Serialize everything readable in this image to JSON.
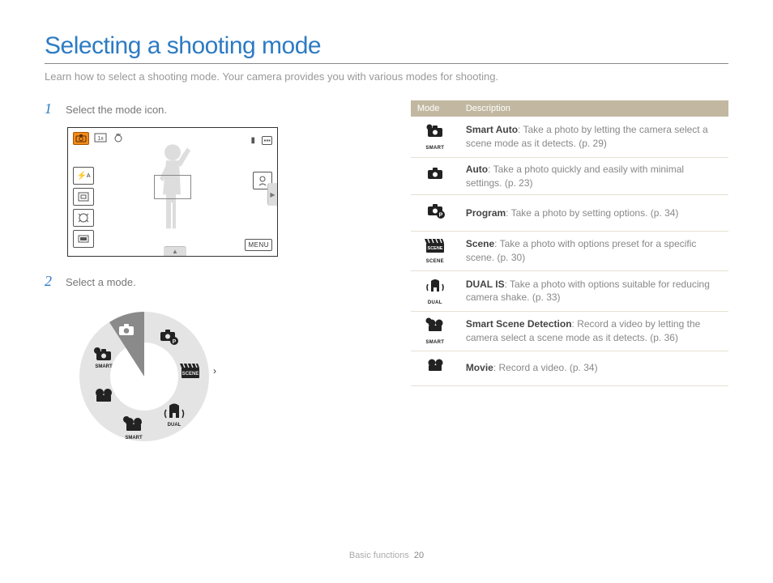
{
  "title": "Selecting a shooting mode",
  "intro": "Learn how to select a shooting mode. Your camera provides you with various modes for shooting.",
  "steps": {
    "s1_num": "1",
    "s1_text": "Select the mode icon.",
    "s2_num": "2",
    "s2_text": "Select a mode."
  },
  "lcd": {
    "menu_label": "MENU"
  },
  "table": {
    "header_mode": "Mode",
    "header_desc": "Description",
    "rows": [
      {
        "icon_sub": "SMART",
        "name": "Smart Auto",
        "desc": ": Take a photo by letting the camera select a scene mode as it detects. (p. 29)"
      },
      {
        "icon_sub": "",
        "name": "Auto",
        "desc": ": Take a photo quickly and easily with minimal settings. (p. 23)"
      },
      {
        "icon_sub": "",
        "name": "Program",
        "desc": ": Take a photo by setting options. (p. 34)"
      },
      {
        "icon_sub": "SCENE",
        "name": "Scene",
        "desc": ": Take a photo with options preset for a specific scene. (p. 30)"
      },
      {
        "icon_sub": "DUAL",
        "name": "DUAL IS",
        "desc": ": Take a photo with options suitable for reducing camera shake. (p. 33)"
      },
      {
        "icon_sub": "SMART",
        "name": "Smart Scene Detection",
        "desc": ": Record a video by letting the camera select a scene mode as it detects. (p. 36)"
      },
      {
        "icon_sub": "",
        "name": "Movie",
        "desc": ": Record a video. (p. 34)"
      }
    ]
  },
  "footer": {
    "section": "Basic functions",
    "page": "20"
  }
}
